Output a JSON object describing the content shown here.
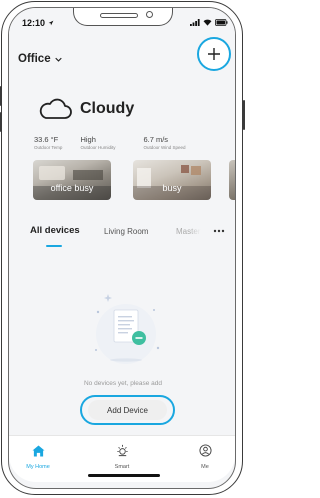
{
  "status_bar": {
    "time": "12:10"
  },
  "header": {
    "home_name": "Office"
  },
  "weather": {
    "condition": "Cloudy",
    "stats": [
      {
        "value": "33.6 °F",
        "label": "Outdoor Temp"
      },
      {
        "value": "High",
        "label": "Outdoor Humidity"
      },
      {
        "value": "6.7 m/s",
        "label": "Outdoor Wind Speed"
      }
    ]
  },
  "scenes": [
    {
      "name": "office busy"
    },
    {
      "name": "busy"
    }
  ],
  "tabs": [
    {
      "label": "All devices",
      "active": true
    },
    {
      "label": "Living Room"
    },
    {
      "label": "Master Room"
    }
  ],
  "empty_state": {
    "message": "No devices yet, please add",
    "button_label": "Add Device"
  },
  "tabbar": [
    {
      "label": "My Home",
      "icon": "home-icon",
      "active": true
    },
    {
      "label": "Smart",
      "icon": "sun-icon"
    },
    {
      "label": "Me",
      "icon": "user-icon"
    }
  ],
  "colors": {
    "accent": "#1aa7e0"
  }
}
